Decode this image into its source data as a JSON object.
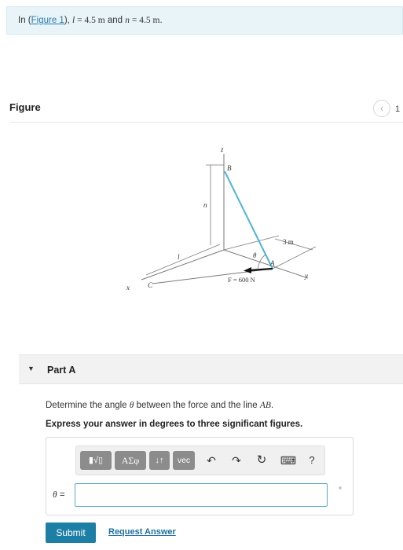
{
  "intro": {
    "prefix": "In (",
    "figure_link": "Figure 1",
    "suffix": "), ",
    "var_l": "l",
    "val_l": " = 4.5 m",
    "and": " and ",
    "var_n": "n",
    "val_n": " = 4.5 m",
    "end": "."
  },
  "figure": {
    "title": "Figure",
    "prev_icon": "chevron-left-icon",
    "number": "1",
    "labels": {
      "z": "z",
      "b": "B",
      "n": "n",
      "l": "l",
      "dim": "3 m",
      "theta": "θ",
      "a": "A",
      "force": "F = 600 N",
      "y": "y",
      "c": "C",
      "x": "x"
    },
    "colors": {
      "cable": "#4fb3d9",
      "axes": "#7a7a7a",
      "force": "#111111"
    }
  },
  "part": {
    "title": "Part A",
    "question_prefix": "Determine the angle ",
    "question_theta": "θ",
    "question_mid": " between the force and the line ",
    "question_ab": "AB",
    "question_end": ".",
    "instruction": "Express your answer in degrees to three significant figures."
  },
  "toolbar": {
    "templates": "▮√▯",
    "greek": "ΑΣφ",
    "arrows": "↓↑",
    "vec": "vec",
    "undo": "↶",
    "redo": "↷",
    "reset": "↻",
    "keyboard": "⌨",
    "help": "?"
  },
  "answer": {
    "label_var": "θ",
    "label_eq": " =",
    "value": "",
    "placeholder": "",
    "unit": "°"
  },
  "actions": {
    "submit": "Submit",
    "request": "Request Answer"
  },
  "colors": {
    "accent": "#1e7fa6",
    "intro_bg": "#e8f4f8",
    "input_border": "#5aa7c8"
  }
}
